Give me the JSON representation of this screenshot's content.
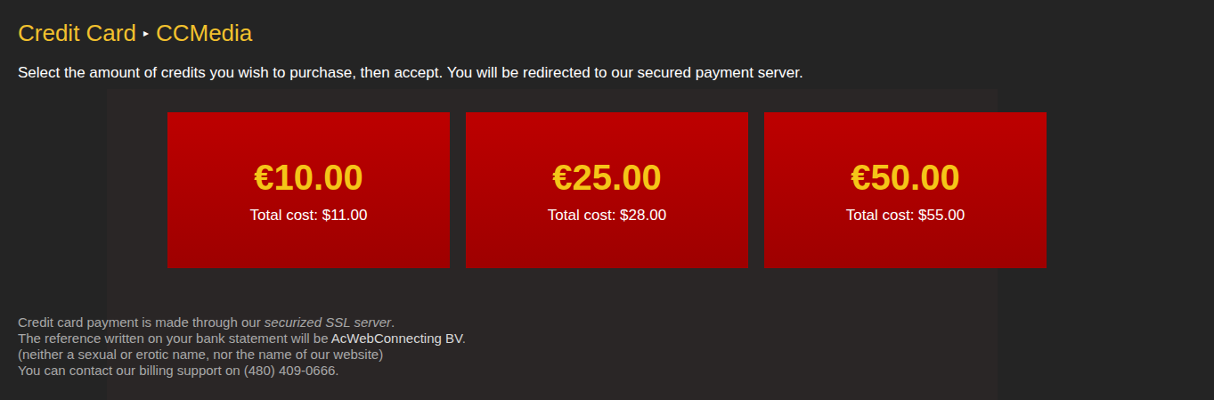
{
  "header": {
    "title": "Credit Card",
    "separator": "▸",
    "provider": "CCMedia"
  },
  "instruction": "Select the amount of credits you wish to purchase, then accept. You will be redirected to our secured payment server.",
  "options": [
    {
      "amount": "€10.00",
      "total": "Total cost: $11.00"
    },
    {
      "amount": "€25.00",
      "total": "Total cost: $28.00"
    },
    {
      "amount": "€50.00",
      "total": "Total cost: $55.00"
    }
  ],
  "footer": [
    [
      {
        "text": "Credit card payment is made through our ",
        "kind": "plain"
      },
      {
        "text": "securized SSL server",
        "kind": "italic"
      },
      {
        "text": ".",
        "kind": "plain"
      }
    ],
    [
      {
        "text": "The reference written on your bank statement will be ",
        "kind": "plain"
      },
      {
        "text": "AcWebConnecting BV",
        "kind": "highlight"
      },
      {
        "text": ".",
        "kind": "plain"
      }
    ],
    [
      {
        "text": "(neither a sexual or erotic name, nor the name of our website)",
        "kind": "plain"
      }
    ],
    [
      {
        "text": "You can contact our billing support on (480) 409-0666.",
        "kind": "plain"
      }
    ]
  ]
}
